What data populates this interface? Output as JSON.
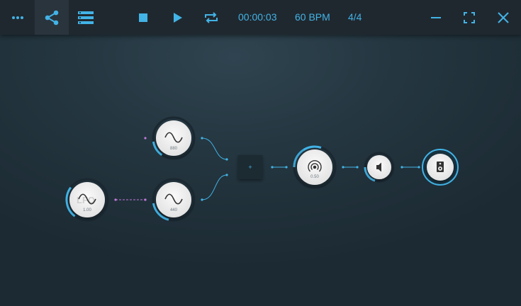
{
  "toolbar": {
    "more_icon": "more-horizontal-icon",
    "graph_view_icon": "share-graph-icon",
    "list_view_icon": "list-view-icon",
    "stop_icon": "stop-icon",
    "play_icon": "play-icon",
    "loop_icon": "loop-icon",
    "time": "00:00:03",
    "tempo": "60 BPM",
    "time_signature": "4/4",
    "minimize_icon": "minimize-icon",
    "fullscreen_icon": "fullscreen-icon",
    "close_icon": "close-icon"
  },
  "colors": {
    "accent": "#42b3e6",
    "toolbar_bg": "#20282f",
    "node_fill": "#ececec",
    "modulation_link": "#c079d8"
  },
  "graph": {
    "nodes": {
      "lfo": {
        "icon": "sine-wave-icon",
        "label": "LFO",
        "value": "1.00"
      },
      "osc_top": {
        "icon": "sine-wave-icon",
        "value": "880"
      },
      "osc_bottom": {
        "icon": "sine-wave-icon",
        "value": "440"
      },
      "mixer": {
        "icon": "plus-icon",
        "symbol": "+"
      },
      "reverb": {
        "icon": "reverb-icon",
        "value": "0.50"
      },
      "volume": {
        "icon": "speaker-volume-icon"
      },
      "output": {
        "icon": "speaker-box-icon"
      }
    }
  }
}
